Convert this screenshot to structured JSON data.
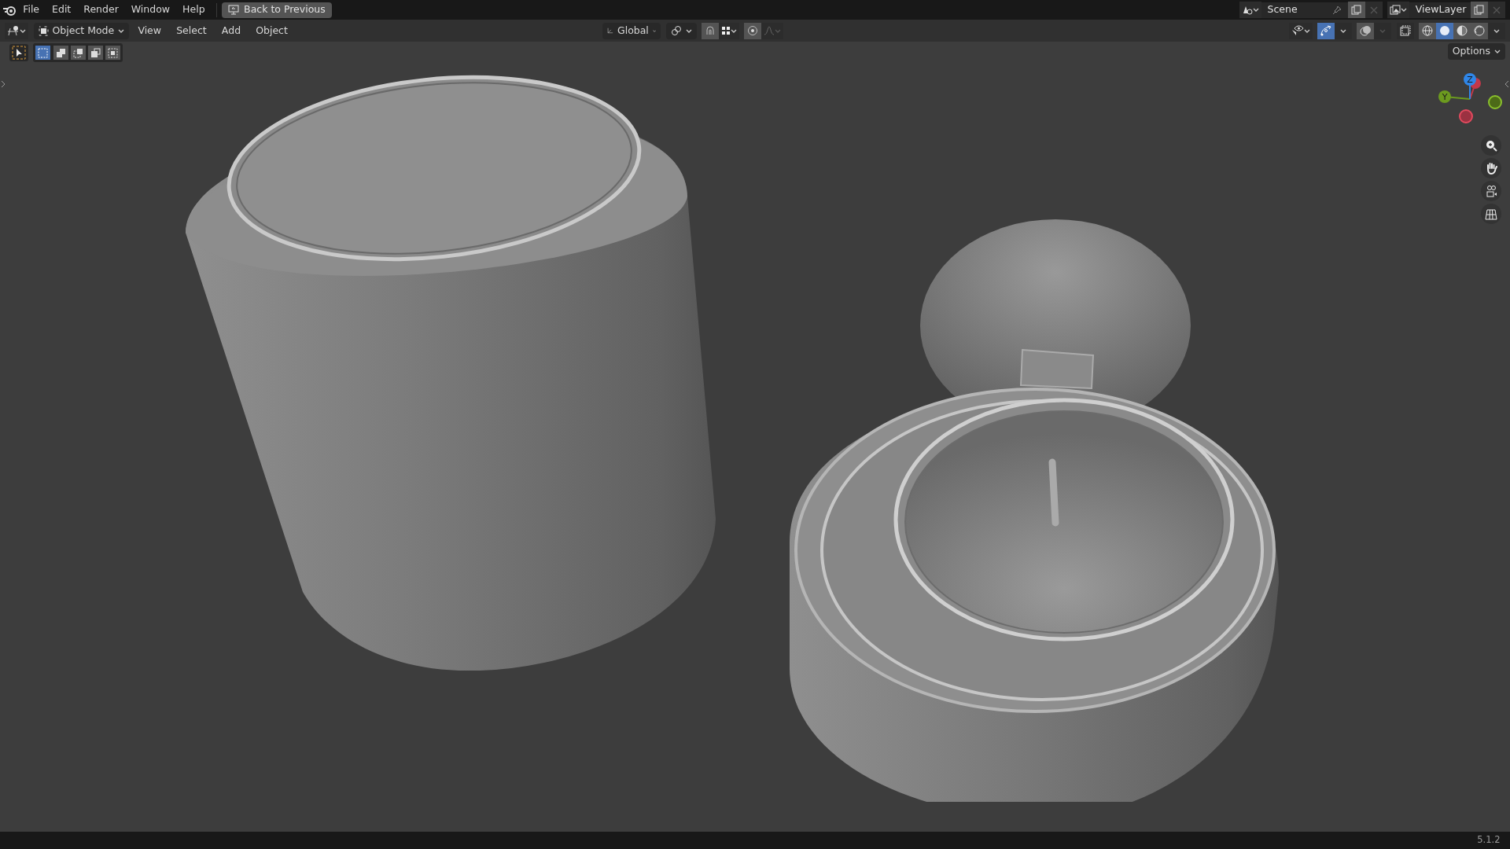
{
  "top_bar": {
    "menus": [
      "File",
      "Edit",
      "Render",
      "Window",
      "Help"
    ],
    "back_button": "Back to Previous",
    "scene": "Scene",
    "view_layer": "ViewLayer"
  },
  "header": {
    "mode": "Object Mode",
    "menus": [
      "View",
      "Select",
      "Add",
      "Object"
    ],
    "orientation": "Global",
    "snap_on": true,
    "proportional_on": true,
    "gizmos_on": true,
    "overlays_on": true,
    "shading": [
      {
        "selected": false
      },
      {
        "selected": true
      },
      {
        "selected": false
      },
      {
        "selected": false
      }
    ]
  },
  "tool_settings": {
    "select_modes": [
      {
        "selected": true
      },
      {
        "selected": false
      },
      {
        "selected": false
      },
      {
        "selected": false
      },
      {
        "selected": false
      }
    ],
    "options": "Options"
  },
  "gizmo": {
    "axes": [
      {
        "label": "Y",
        "color": "#6c9a1f"
      },
      {
        "label": "Z",
        "color": "#2f86e8"
      }
    ]
  },
  "status_bar": {
    "version": "5.1.2"
  }
}
